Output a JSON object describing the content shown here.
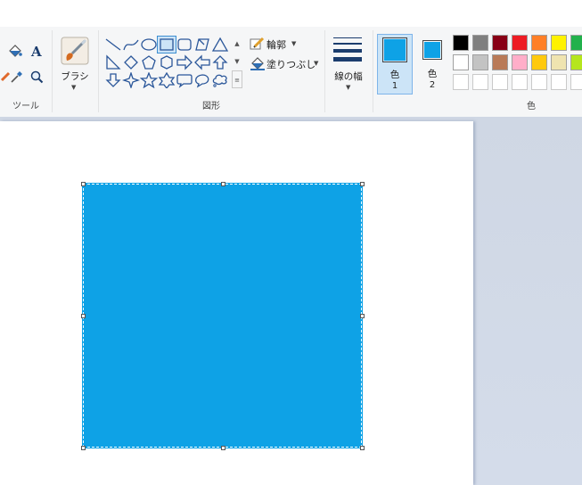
{
  "ribbon": {
    "tools_group_label": "ツール",
    "brush_label": "ブラシ",
    "shapes_group_label": "図形",
    "outline_label": "輪郭",
    "fill_label": "塗りつぶし",
    "line_width_label": "線の幅",
    "color1_label": "色",
    "color1_number": "1",
    "color2_label": "色",
    "color2_number": "2",
    "colors_group_label": "色",
    "color1_value": "#0ea2e6",
    "color2_value": "#0ea2e6",
    "palette_row1": [
      "#000000",
      "#7f7f7f",
      "#880015",
      "#ed1c24",
      "#ff7f27",
      "#fff200",
      "#22b14c"
    ],
    "palette_row2": [
      "#ffffff",
      "#c3c3c3",
      "#b97a57",
      "#ffaec9",
      "#ffc90e",
      "#efe4b0",
      "#b5e61d"
    ],
    "shapes": [
      "line",
      "curve",
      "oval",
      "rectangle",
      "rounded-rectangle",
      "polygon",
      "triangle",
      "right-triangle",
      "diamond",
      "pentagon",
      "hexagon",
      "right-arrow",
      "left-arrow",
      "up-arrow",
      "down-arrow",
      "four-point-star",
      "five-point-star",
      "six-point-star",
      "rounded-callout",
      "oval-callout",
      "cloud-callout"
    ],
    "selected_shape": "rectangle"
  },
  "canvas": {
    "shape_fill": "#0ea2e6"
  }
}
